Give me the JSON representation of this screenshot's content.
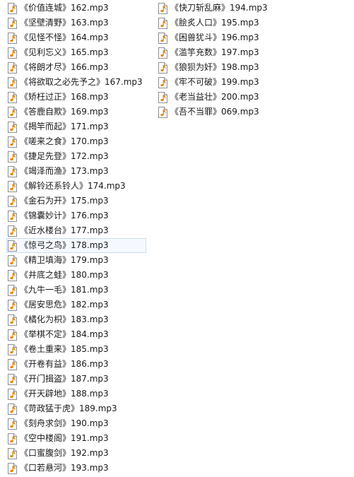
{
  "files": {
    "column_1": [
      {
        "name": "《价值连城》162.mp3"
      },
      {
        "name": "《坚壁清野》163.mp3"
      },
      {
        "name": "《见怪不怪》164.mp3"
      },
      {
        "name": "《见利忘义》165.mp3"
      },
      {
        "name": "《将朗才尽》166.mp3"
      },
      {
        "name": "《将欲取之必先予之》167.mp3"
      },
      {
        "name": "《矫枉过正》168.mp3"
      },
      {
        "name": "《答鹿自欺》169.mp3"
      },
      {
        "name": "《揭竿而起》171.mp3"
      },
      {
        "name": "《嗟来之食》170.mp3"
      },
      {
        "name": "《捷足先登》172.mp3"
      },
      {
        "name": "《竭泽而渔》173.mp3"
      },
      {
        "name": "《解铃还系铃人》174.mp3"
      },
      {
        "name": "《金石为开》175.mp3"
      },
      {
        "name": "《锦囊妙计》176.mp3"
      },
      {
        "name": "《近水楼台》177.mp3"
      },
      {
        "name": "《惊弓之鸟》178.mp3"
      },
      {
        "name": "《精卫填海》179.mp3"
      },
      {
        "name": "《井底之蛙》180.mp3"
      },
      {
        "name": "《九牛一毛》181.mp3"
      },
      {
        "name": "《居安思危》182.mp3"
      },
      {
        "name": "《橘化为枳》183.mp3"
      },
      {
        "name": "《举棋不定》184.mp3"
      },
      {
        "name": "《卷土重来》185.mp3"
      },
      {
        "name": "《开卷有益》186.mp3"
      },
      {
        "name": "《开门揖盗》187.mp3"
      },
      {
        "name": "《开天辟地》188.mp3"
      },
      {
        "name": "《苛政猛于虎》189.mp3"
      },
      {
        "name": "《刻舟求剑》190.mp3"
      },
      {
        "name": "《空中楼阁》191.mp3"
      },
      {
        "name": "《口蜜腹剑》192.mp3"
      },
      {
        "name": "《口若悬河》193.mp3"
      }
    ],
    "column_2": [
      {
        "name": "《快刀斩乱麻》194.mp3"
      },
      {
        "name": "《脍炙人口》195.mp3"
      },
      {
        "name": "《困兽犹斗》196.mp3"
      },
      {
        "name": "《滥竽充数》197.mp3"
      },
      {
        "name": "《狼狈为奸》198.mp3"
      },
      {
        "name": "《牢不可破》199.mp3"
      },
      {
        "name": "《老当益壮》200.mp3"
      },
      {
        "name": "《吾不当罪》069.mp3"
      }
    ],
    "selected_item": "《惊弓之鸟》178.mp3"
  },
  "icon": {
    "name": "audio-file-icon",
    "page_color": "#ffffff",
    "border_color": "#8f8f8f",
    "fold_color": "#e6e6e6",
    "note_color": "#e08a12"
  },
  "selection_colors": {
    "background": "#f5f9ff",
    "border": "#c9dcf3"
  }
}
